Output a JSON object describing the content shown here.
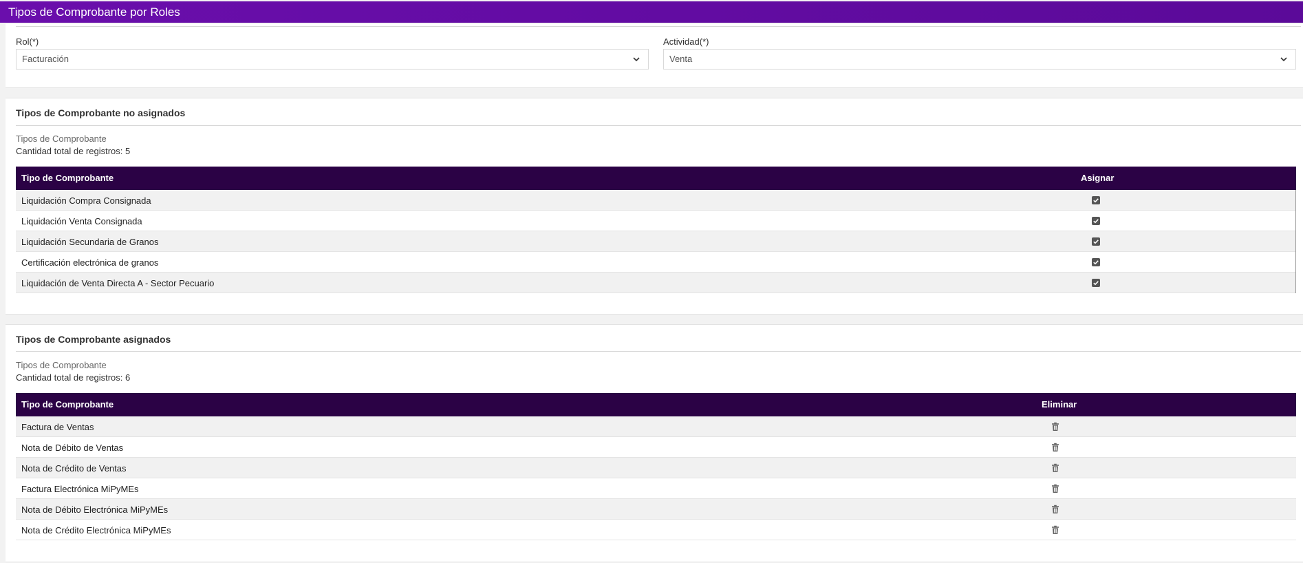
{
  "page": {
    "title": "Tipos de Comprobante por Roles"
  },
  "filters": {
    "rol": {
      "label": "Rol(*)",
      "value": "Facturación"
    },
    "actividad": {
      "label": "Actividad(*)",
      "value": "Venta"
    }
  },
  "unassigned": {
    "section_title": "Tipos de Comprobante no asignados",
    "list_label": "Tipos de Comprobante",
    "count_label": "Cantidad total de registros: 5",
    "columns": [
      "Tipo de Comprobante",
      "Asignar"
    ],
    "rows": [
      "Liquidación Compra Consignada",
      "Liquidación Venta Consignada",
      "Liquidación Secundaria de Granos",
      "Certificación electrónica de granos",
      "Liquidación de Venta Directa A - Sector Pecuario"
    ],
    "action_icon": "checkbox-checked-icon"
  },
  "assigned": {
    "section_title": "Tipos de Comprobante asignados",
    "list_label": "Tipos de Comprobante",
    "count_label": "Cantidad total de registros: 6",
    "columns": [
      "Tipo de Comprobante",
      "Eliminar"
    ],
    "rows": [
      "Factura de Ventas",
      "Nota de Débito de Ventas",
      "Nota de Crédito de Ventas",
      "Factura Electrónica MiPyMEs",
      "Nota de Débito Electrónica MiPyMEs",
      "Nota de Crédito Electrónica MiPyMEs"
    ],
    "action_icon": "trash-icon"
  },
  "colors": {
    "header_bar": "#6a0eac",
    "table_header": "#2b0245"
  }
}
